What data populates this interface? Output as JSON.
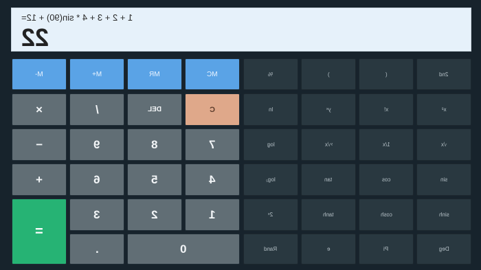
{
  "display": {
    "expression": "1 + 2 + 3 + 4 * sin(90) + 12=",
    "result": "22"
  },
  "memory": [
    "M-",
    "M+",
    "MR",
    "MC"
  ],
  "controls": {
    "multiply": "×",
    "divide": "/",
    "delete": "DEL",
    "clear": "C",
    "minus": "−",
    "plus": "+",
    "equals": "=",
    "decimal": "."
  },
  "digits": {
    "d0": "0",
    "d1": "1",
    "d2": "2",
    "d3": "3",
    "d4": "4",
    "d5": "5",
    "d6": "6",
    "d7": "7",
    "d8": "8",
    "d9": "9"
  },
  "scientific": {
    "row1": [
      "%",
      ")",
      "(",
      "2nd"
    ],
    "row2": [
      "ln",
      "yˣ",
      "x!",
      "x²"
    ],
    "row3": [
      "log",
      "ʸ√x",
      "1/x",
      "√x"
    ],
    "row4": [
      "log₂",
      "tan",
      "cos",
      "sin"
    ],
    "row5": [
      "2ˣ",
      "tanh",
      "cosh",
      "sinh"
    ],
    "row6": [
      "Rand",
      "e",
      "Pi",
      "Deg"
    ]
  },
  "colors": {
    "memory": "#5aa3e6",
    "number": "#616e75",
    "clear": "#dfa88a",
    "equals": "#26b374",
    "scientific": "#293840",
    "background": "#17232c"
  }
}
